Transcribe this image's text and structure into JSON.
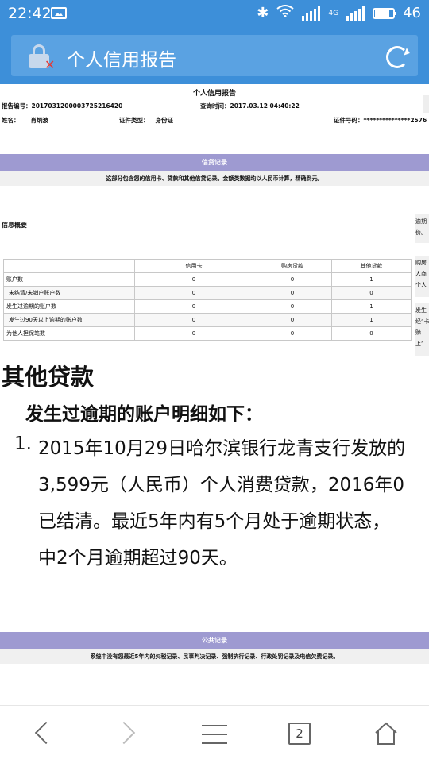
{
  "status_bar": {
    "time": "22:42",
    "network_label": "4G",
    "battery_level": "46"
  },
  "browser": {
    "page_title": "个人信用报告",
    "icons": [
      "lock-insecure-icon",
      "refresh-icon"
    ]
  },
  "report": {
    "title": "个人信用报告",
    "report_no_label": "报告编号：",
    "report_no": "2017031200003725216420",
    "query_time_label": "查询时间：",
    "query_time": "2017.03.12 04:40:22",
    "name_label": "姓名：",
    "name": "肖炳波",
    "id_type_label": "证件类型：",
    "id_type": "身份证",
    "id_no_label": "证件号码：",
    "id_no": "***************2576",
    "credit_section_title": "信贷记录",
    "credit_section_note": "这部分包含您的信用卡、贷款和其他信贷记录。金额类数据均以人民币计算，精确到元。",
    "overview_label": "信息概要",
    "side_note_1": "逾期价。",
    "side_note_2": "购房人商个人",
    "side_note_3": "发生经“卡赊上”",
    "table": {
      "columns": [
        "",
        "信用卡",
        "购房贷款",
        "其他贷款"
      ],
      "rows": [
        {
          "label": "账户数",
          "values": [
            "0",
            "0",
            "1"
          ]
        },
        {
          "label": "未结清/未销户账户数",
          "values": [
            "0",
            "0",
            "0"
          ]
        },
        {
          "label": "发生过逾期的账户数",
          "values": [
            "0",
            "0",
            "1"
          ]
        },
        {
          "label": "发生过90天以上逾期的账户数",
          "values": [
            "0",
            "0",
            "1"
          ]
        },
        {
          "label": "为他人担保笔数",
          "values": [
            "0",
            "0",
            "0"
          ]
        }
      ]
    },
    "other_loans_heading": "其他贷款",
    "overdue_heading": "发生过逾期的账户明细如下：",
    "item_number": "1.",
    "item_lines": [
      "2015年10月29日哈尔滨银行龙青支行发放的",
      "3,599元（人民币）个人消费贷款，2016年0",
      "已结清。最近5年内有5个月处于逾期状态，",
      "中2个月逾期超过90天。"
    ],
    "public_section_title": "公共记录",
    "public_section_note": "系统中没有您最近5年内的欠税记录、民事判决记录、强制执行记录、行政处罚记录及电信欠费记录。"
  },
  "bottom_nav": {
    "tab_count": "2",
    "icons": [
      "back-icon",
      "forward-icon",
      "menu-icon",
      "tabs-icon",
      "home-icon"
    ]
  }
}
